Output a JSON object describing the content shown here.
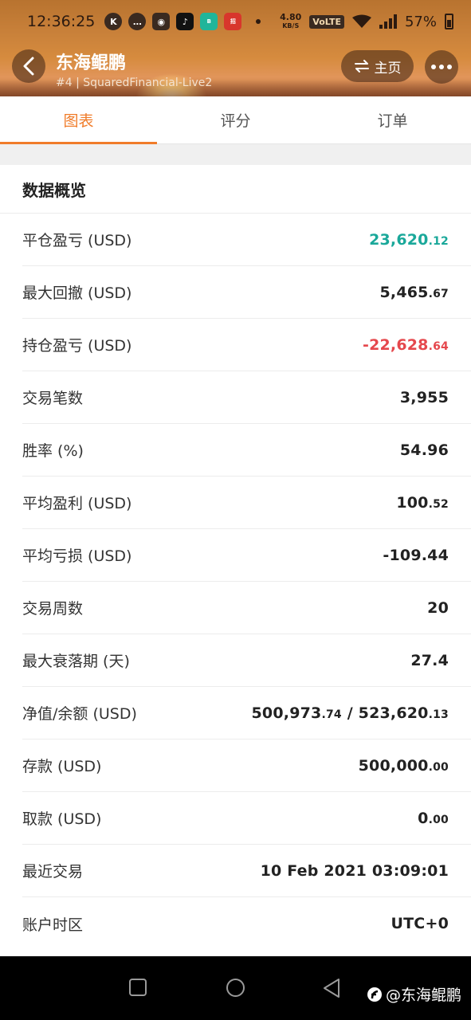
{
  "status": {
    "time": "12:36:25",
    "net_speed_value": "4.80",
    "net_speed_unit": "KB/S",
    "volte": "VoLTE",
    "battery": "57%"
  },
  "header": {
    "title": "东海鲲鹏",
    "subtitle": "#4 | SquaredFinancial-Live2",
    "home_label": "主页"
  },
  "tabs": [
    {
      "label": "图表",
      "active": true
    },
    {
      "label": "评分",
      "active": false
    },
    {
      "label": "订单",
      "active": false
    }
  ],
  "overview": {
    "title": "数据概览",
    "rows": [
      {
        "label": "平仓盈亏 (USD)",
        "int": "23,620",
        "dec": ".12",
        "tone": "positive"
      },
      {
        "label": "最大回撤 (USD)",
        "int": "5,465",
        "dec": ".67",
        "tone": "normal"
      },
      {
        "label": "持仓盈亏 (USD)",
        "int": "-22,628",
        "dec": ".64",
        "tone": "negative"
      },
      {
        "label": "交易笔数",
        "int": "3,955",
        "dec": "",
        "tone": "normal"
      },
      {
        "label": "胜率 (%)",
        "int": "54.96",
        "dec": "",
        "tone": "normal"
      },
      {
        "label": "平均盈利 (USD)",
        "int": "100",
        "dec": ".52",
        "tone": "normal"
      },
      {
        "label": "平均亏损 (USD)",
        "int": "-109.44",
        "dec": "",
        "tone": "normal"
      },
      {
        "label": "交易周数",
        "int": "20",
        "dec": "",
        "tone": "normal"
      },
      {
        "label": "最大衰落期 (天)",
        "int": "27.4",
        "dec": "",
        "tone": "normal"
      },
      {
        "label": "净值/余额 (USD)",
        "int": "500,973",
        "dec": ".74",
        "int2": " / 523,620",
        "dec2": ".13",
        "tone": "normal"
      },
      {
        "label": "存款 (USD)",
        "int": "500,000",
        "dec": ".00",
        "tone": "normal"
      },
      {
        "label": "取款 (USD)",
        "int": "0",
        "dec": ".00",
        "tone": "normal"
      },
      {
        "label": "最近交易",
        "int": "10 Feb 2021 03:09:01",
        "dec": "",
        "tone": "normal"
      },
      {
        "label": "账户时区",
        "int": "UTC+0",
        "dec": "",
        "tone": "normal"
      }
    ]
  },
  "watermark": "@东海鲲鹏",
  "colors": {
    "accent": "#f07c2a",
    "positive": "#1aa89a",
    "negative": "#e5484d"
  }
}
